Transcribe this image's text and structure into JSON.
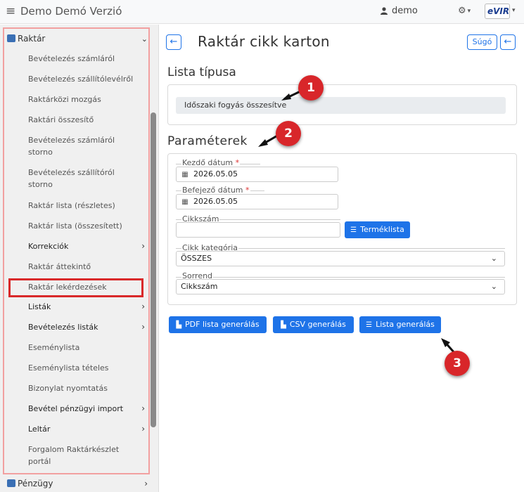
{
  "header": {
    "app_title": "Demo Demó Verzió",
    "user": "demo",
    "logo_text": "eVIR"
  },
  "sidebar": {
    "group_label": "Raktár",
    "items": [
      {
        "label": "Bevételezés számláról"
      },
      {
        "label": "Bevételezés szállítólevélről"
      },
      {
        "label": "Raktárközi mozgás"
      },
      {
        "label": "Raktári összesítő"
      },
      {
        "label": "Bevételezés számláról storno"
      },
      {
        "label": "Bevételezés szállítóról storno"
      },
      {
        "label": "Raktár lista (részletes)"
      },
      {
        "label": "Raktár lista (összesített)"
      },
      {
        "label": "Korrekciók",
        "submenu": true
      },
      {
        "label": "Raktár áttekintő"
      },
      {
        "label": "Raktár lekérdezések",
        "highlighted": true
      },
      {
        "label": "Listák",
        "submenu": true
      },
      {
        "label": "Bevételezés listák",
        "submenu": true
      },
      {
        "label": "Eseménylista"
      },
      {
        "label": "Eseménylista tételes"
      },
      {
        "label": "Bizonylat nyomtatás"
      },
      {
        "label": "Bevétel pénzügyi import",
        "submenu": true
      },
      {
        "label": "Leltár",
        "submenu": true
      },
      {
        "label": "Forgalom Raktárkészlet portál"
      }
    ],
    "next_group_label": "Pénzügy"
  },
  "main": {
    "title": "Raktár cikk karton",
    "help_label": "Súgó",
    "list_type_heading": "Lista típusa",
    "list_type_value": "Időszaki fogyás összesítve",
    "params_heading": "Paraméterek",
    "start_date_label": "Kezdő dátum",
    "start_date_value": "2026.05.05",
    "end_date_label": "Befejező dátum",
    "end_date_value": "2026.05.05",
    "item_no_label": "Cikkszám",
    "item_no_value": "",
    "product_list_button": "Terméklista",
    "category_label": "Cikk kategória",
    "category_value": "ÖSSZES",
    "order_label": "Sorrend",
    "order_value": "Cikkszám",
    "required_mark": "*",
    "buttons": {
      "pdf": "PDF lista generálás",
      "csv": "CSV generálás",
      "list": "Lista generálás"
    }
  },
  "annotations": [
    "1",
    "2",
    "3"
  ],
  "colors": {
    "accent": "#1e73e8",
    "badge": "#d8262a",
    "highlight_frame": "#d9292a"
  }
}
